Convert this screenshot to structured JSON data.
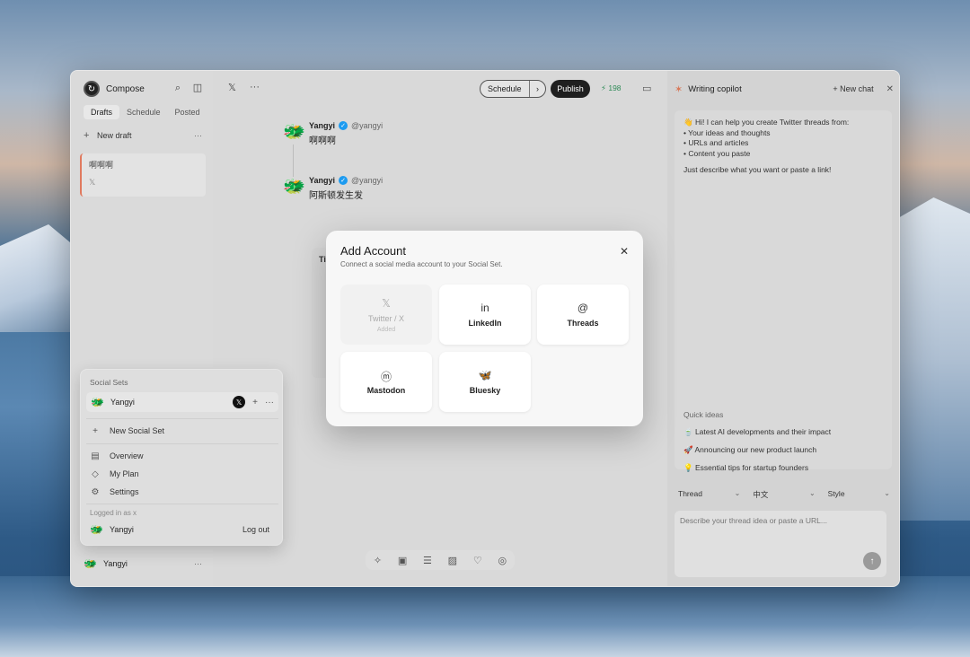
{
  "app": {
    "name": "Compose"
  },
  "sidebar": {
    "tabs": [
      {
        "label": "Drafts"
      },
      {
        "label": "Schedule"
      },
      {
        "label": "Posted"
      }
    ],
    "new_draft_label": "New draft",
    "drafts": [
      {
        "title": "啊啊啊",
        "platform_icon": "x-icon"
      }
    ],
    "footer_user": {
      "name": "Yangyi"
    }
  },
  "social_sets_popover": {
    "title": "Social Sets",
    "active_set": {
      "name": "Yangyi"
    },
    "new_set_label": "New Social Set",
    "items": [
      {
        "label": "Overview",
        "icon": "overview-icon"
      },
      {
        "label": "My Plan",
        "icon": "diamond-icon"
      },
      {
        "label": "Settings",
        "icon": "gear-icon"
      }
    ],
    "logged_in_label": "Logged in as x",
    "logged_user": "Yangyi",
    "logout_label": "Log out"
  },
  "toolbar": {
    "schedule_label": "Schedule",
    "publish_label": "Publish",
    "char_count": "198"
  },
  "thread": {
    "posts": [
      {
        "author": "Yangyi",
        "handle": "@yangyi",
        "text": "啊啊啊"
      },
      {
        "author": "Yangyi",
        "handle": "@yangyi",
        "text": "阿斯顿发生发"
      }
    ],
    "tips_title": "Tip"
  },
  "copilot": {
    "title": "Writing copilot",
    "new_chat_label": "New chat",
    "intro": {
      "line1": "👋 Hi! I can help you create Twitter threads from:",
      "bullets": [
        "• Your ideas and thoughts",
        "• URLs and articles",
        "• Content you paste"
      ],
      "closing": "Just describe what you want or paste a link!"
    },
    "quick_ideas_label": "Quick ideas",
    "quick_ideas": [
      "🍵 Latest AI developments and their impact",
      "🚀 Announcing our new product launch",
      "💡 Essential tips for startup founders"
    ],
    "selects": [
      {
        "value": "Thread"
      },
      {
        "value": "中文"
      },
      {
        "value": "Style"
      }
    ],
    "prompt_placeholder": "Describe your thread idea or paste a URL..."
  },
  "modal": {
    "title": "Add Account",
    "subtitle": "Connect a social media account to your Social Set.",
    "accounts": [
      {
        "label": "Twitter / X",
        "icon": "x-icon",
        "status": "Added",
        "disabled": true
      },
      {
        "label": "LinkedIn",
        "icon": "linkedin-icon"
      },
      {
        "label": "Threads",
        "icon": "threads-icon"
      },
      {
        "label": "Mastodon",
        "icon": "mastodon-icon"
      },
      {
        "label": "Bluesky",
        "icon": "bluesky-icon"
      }
    ]
  }
}
